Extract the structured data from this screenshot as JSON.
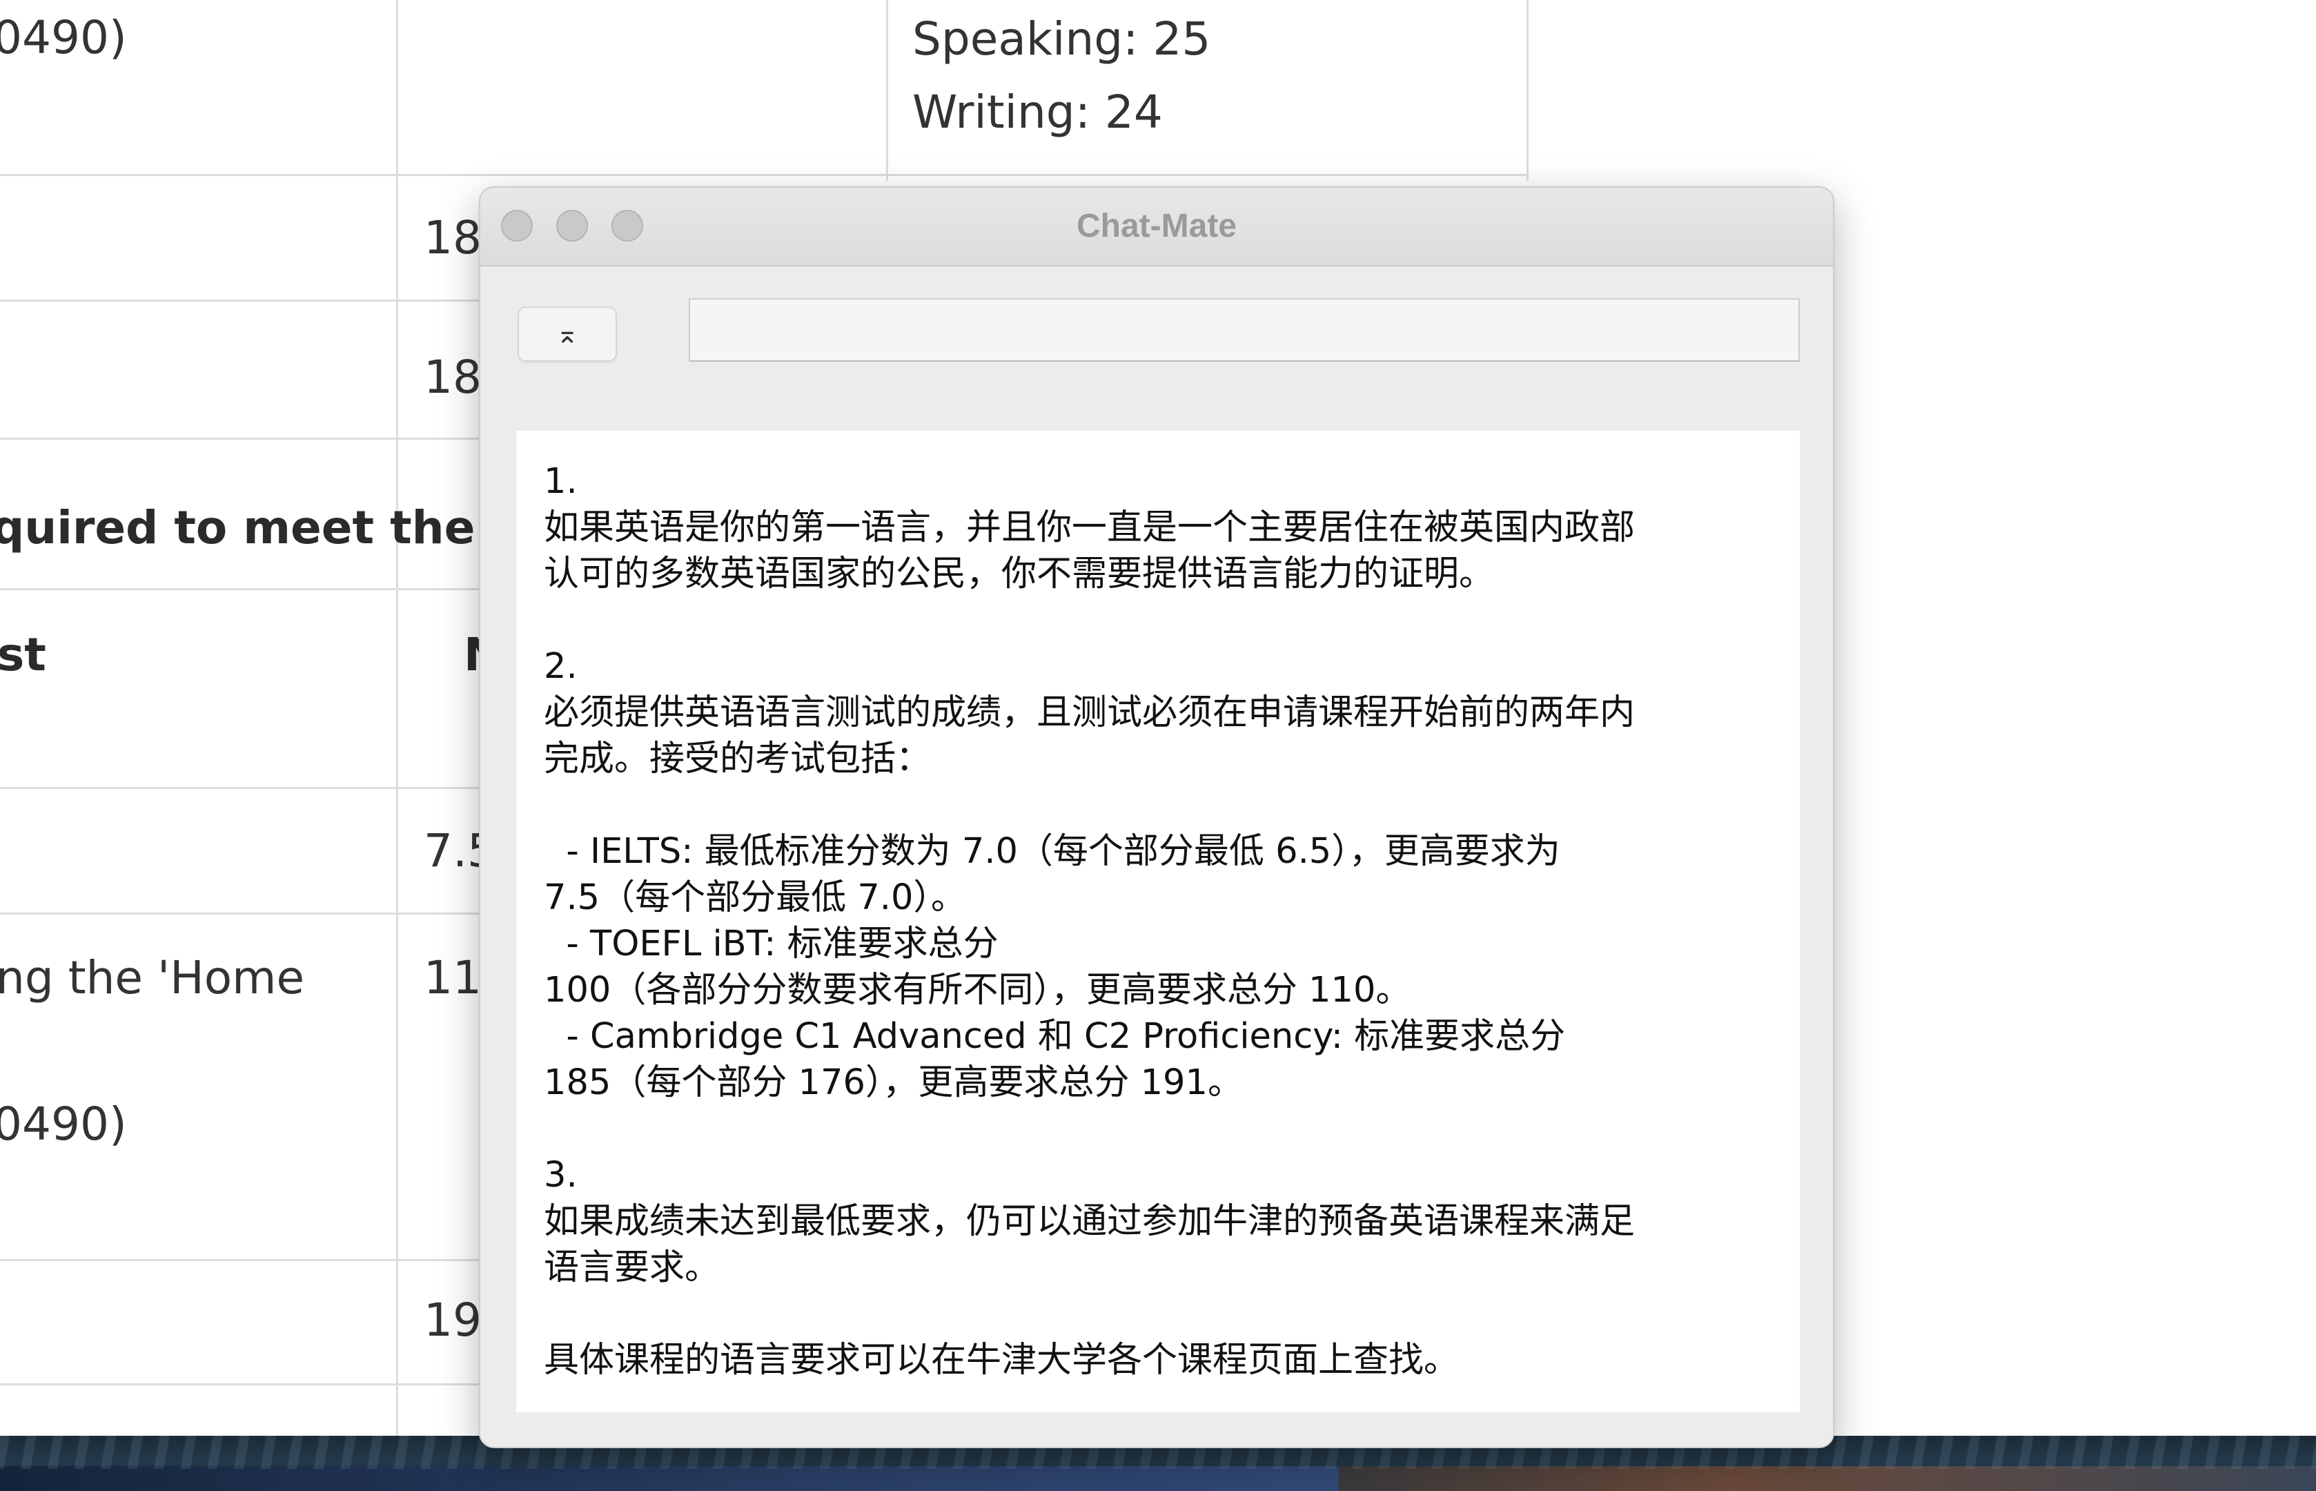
{
  "background_page": {
    "cells": {
      "row1_col1": "0490)",
      "row1_col3_line1": "Speaking: 25",
      "row1_col3_line2": "Writing: 24",
      "row2_col2": "18",
      "row3_col2": "18",
      "section_heading": "quired to meet the Univ",
      "header_col1": "st",
      "header_col2": "N",
      "row4_col2": "7.5",
      "row5_col1_line1": "ng the 'Home",
      "row5_col1_line2": "0490)",
      "row5_col2": "11",
      "row6_col2": "19"
    }
  },
  "chat_window": {
    "title": "Chat-Mate",
    "toolbar_button_label": "⌅",
    "input_value": "",
    "input_placeholder": "",
    "response_lines": [
      "1.",
      "如果英语是你的第一语言，并且你一直是一个主要居住在被英国内政部",
      "认可的多数英语国家的公民，你不需要提供语言能力的证明。",
      "",
      "2.",
      "必须提供英语语言测试的成绩，且测试必须在申请课程开始前的两年内",
      "完成。接受的考试包括：",
      "",
      "  - IELTS: 最低标准分数为 7.0（每个部分最低 6.5），更高要求为",
      "7.5（每个部分最低 7.0）。",
      "  - TOEFL iBT: 标准要求总分",
      "100（各部分分数要求有所不同），更高要求总分 110。",
      "  - Cambridge C1 Advanced 和 C2 Proficiency: 标准要求总分",
      "185（每个部分 176），更高要求总分 191。",
      "",
      "3.",
      "如果成绩未达到最低要求，仍可以通过参加牛津的预备英语课程来满足",
      "语言要求。",
      "",
      "具体课程的语言要求可以在牛津大学各个课程页面上查找。"
    ]
  }
}
